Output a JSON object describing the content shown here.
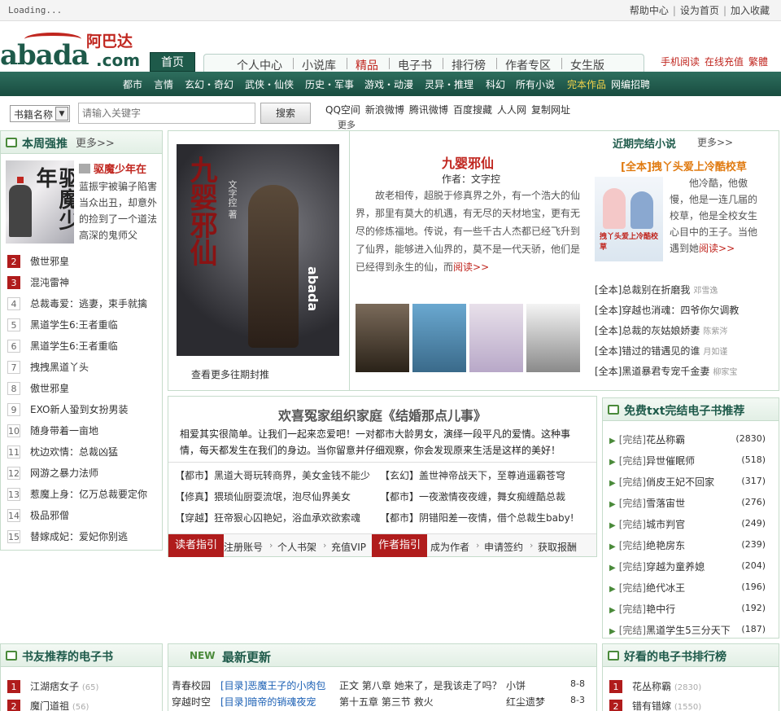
{
  "topbar": {
    "loading": "Loading...",
    "links": [
      "帮助中心",
      "设为首页",
      "加入收藏"
    ]
  },
  "logo": {
    "brand_cn": "阿巴达",
    "brand_en_1": "abada",
    "brand_en_2": ".com"
  },
  "nav": {
    "home": "首页",
    "tabs": [
      "个人中心",
      "小说库",
      "精品",
      "电子书",
      "排行榜",
      "作者专区",
      "女生版"
    ],
    "right_links": [
      "手机阅读",
      "在线充值",
      "繁體"
    ]
  },
  "categories": [
    "都市",
    "言情",
    "玄幻・奇幻",
    "武侠・仙侠",
    "历史・军事",
    "游戏・动漫",
    "灵异・推理",
    "科幻",
    "所有小说",
    "完本作品",
    "网编招聘"
  ],
  "search": {
    "select_value": "书籍名称",
    "placeholder": "请输入关键字",
    "button": "搜索",
    "share": [
      "QQ空间",
      "新浪微博",
      "腾讯微博",
      "百度搜藏",
      "人人网",
      "复制网址"
    ],
    "share_more": "更多"
  },
  "week": {
    "title": "本周强推",
    "more": "更多>>",
    "book_title": "驱魔少年在",
    "cover_title": "驱魔少年",
    "desc": "蓝振宇被骗子陷害当众出丑，却意外的捡到了一个道法高深的鬼师父",
    "list": [
      {
        "n": "2",
        "title": "傲世邪皇"
      },
      {
        "n": "3",
        "title": "混沌雷神"
      },
      {
        "n": "4",
        "title": "总裁毒爱：逃妻，束手就擒"
      },
      {
        "n": "5",
        "title": "黑道学生6:王者重临"
      },
      {
        "n": "6",
        "title": "黑道学生6:王者重临"
      },
      {
        "n": "7",
        "title": "拽拽黑道丫头"
      },
      {
        "n": "8",
        "title": "傲世邪皇"
      },
      {
        "n": "9",
        "title": "EXO新人蛩到女扮男装"
      },
      {
        "n": "10",
        "title": "随身带着一亩地"
      },
      {
        "n": "11",
        "title": "枕边欢情：总裁凶猛"
      },
      {
        "n": "12",
        "title": "网游之暴力法师"
      },
      {
        "n": "13",
        "title": "惹魔上身：亿万总裁要定你"
      },
      {
        "n": "14",
        "title": "极品邪僧"
      },
      {
        "n": "15",
        "title": "替嫁成妃：爱妃你别逃"
      }
    ]
  },
  "feature": {
    "cover_title": "九婴邪仙",
    "cover_author": "文字控 著",
    "cover_brand": "abada",
    "more_covers": "查看更多往期封推",
    "title": "九婴邪仙",
    "author": "作者：文字控",
    "desc": "故老相传，超脱于修真界之外，有一个浩大的仙界，那里有莫大的机遇，有无尽的天材地宝，更有无尽的修炼福地。传说，有一些千古人杰都已经飞升到了仙界，能够进入仙界的，莫不是一代天骄，他们是已经得到永生的仙，而",
    "read": "阅读>>"
  },
  "recent": {
    "head": "近期完结小说",
    "more": "更多>>",
    "title": "[全本]拽丫头爱上冷酷校草",
    "cover_title": "拽丫头爱上冷酷校草",
    "desc": "他冷酷，他傲慢，他是一连几届的校草，他是全校女生心目中的王子。当他遇到她",
    "read": "阅读>>",
    "list": [
      {
        "title": "[全本]总裁别在折磨我",
        "author": "邓雪逸"
      },
      {
        "title": "[全本]穿越也消魂：四爷你欠调教",
        "author": ""
      },
      {
        "title": "[全本]总裁的灰姑娘娇妻",
        "author": "陈紫涔"
      },
      {
        "title": "[全本]错过的错遇见的谁",
        "author": "月如谨"
      },
      {
        "title": "[全本]黑道暴君专宠千金妻",
        "author": "柳家宝"
      }
    ]
  },
  "welcome": {
    "title": "欢喜冤家组织家庭《结婚那点儿事》",
    "desc": "相爱其实很简单。让我们一起来恋爱吧！一对都市大龄男女，演绎一段平凡的爱情。这种事情，每天都发生在我们的身边。当你留意并仔细观察，你会发现原来生活是这样的美好！",
    "links": [
      "【都市】黑道大哥玩转商界，美女金钱不能少",
      "【玄幻】盖世神帝战天下，至尊逍遥霸苍穹",
      "【修真】猥琐仙厨耍流氓，泡尽仙界美女",
      "【都市】一夜激情夜夜缠，舞女痴缠酷总裁",
      "【穿越】狂帝狠心囚艳妃，浴血承欢欲索魂",
      "【都市】阴错阳差一夜情，借个总裁生baby!"
    ],
    "reader_guide": "读者指引",
    "reader_items": [
      "注册账号",
      "个人书架",
      "充值VIP"
    ],
    "author_guide": "作者指引",
    "author_items": [
      "成为作者",
      "申请签约",
      "获取报酬"
    ]
  },
  "free": {
    "title": "免费txt完结电子书推荐",
    "list": [
      {
        "tag": "[完结]",
        "title": "花丛称霸",
        "count": "(2830)"
      },
      {
        "tag": "[完结]",
        "title": "异世催眠师",
        "count": "(518)"
      },
      {
        "tag": "[完结]",
        "title": "俏皮王妃不回家",
        "count": "(317)"
      },
      {
        "tag": "[完结]",
        "title": "雪落宙世",
        "count": "(276)"
      },
      {
        "tag": "[完结]",
        "title": "城市判官",
        "count": "(249)"
      },
      {
        "tag": "[完结]",
        "title": "绝艳房东",
        "count": "(239)"
      },
      {
        "tag": "[完结]",
        "title": "穿越为童养媳",
        "count": "(204)"
      },
      {
        "tag": "[完结]",
        "title": "绝代冰王",
        "count": "(196)"
      },
      {
        "tag": "[完结]",
        "title": "艳中行",
        "count": "(192)"
      },
      {
        "tag": "[完结]",
        "title": "黑道学生5三分天下",
        "count": "(187)"
      }
    ]
  },
  "friend": {
    "title": "书友推荐的电子书",
    "list": [
      {
        "n": "1",
        "title": "江湖痞女子",
        "count": "(65)"
      },
      {
        "n": "2",
        "title": "魔门道祖",
        "count": "(56)"
      }
    ]
  },
  "latest": {
    "title_new": "NEW",
    "title": "最新更新",
    "rows": [
      {
        "cat": "青春校园",
        "book": "[目录]恶魔王子的小肉包",
        "chapter": "正文 第八章 她来了，是我该走了吗？",
        "author": "小饼",
        "date": "8-8"
      },
      {
        "cat": "穿越时空",
        "book": "[目录]暗帝的销魂夜宠",
        "chapter": "第十五章 第三节 救火",
        "author": "红尘遗梦",
        "date": "8-3"
      }
    ]
  },
  "rank": {
    "title": "好看的电子书排行榜",
    "list": [
      {
        "n": "1",
        "title": "花丛称霸",
        "count": "(2830)"
      },
      {
        "n": "2",
        "title": "错有错嫁",
        "count": "(1550)"
      }
    ]
  }
}
